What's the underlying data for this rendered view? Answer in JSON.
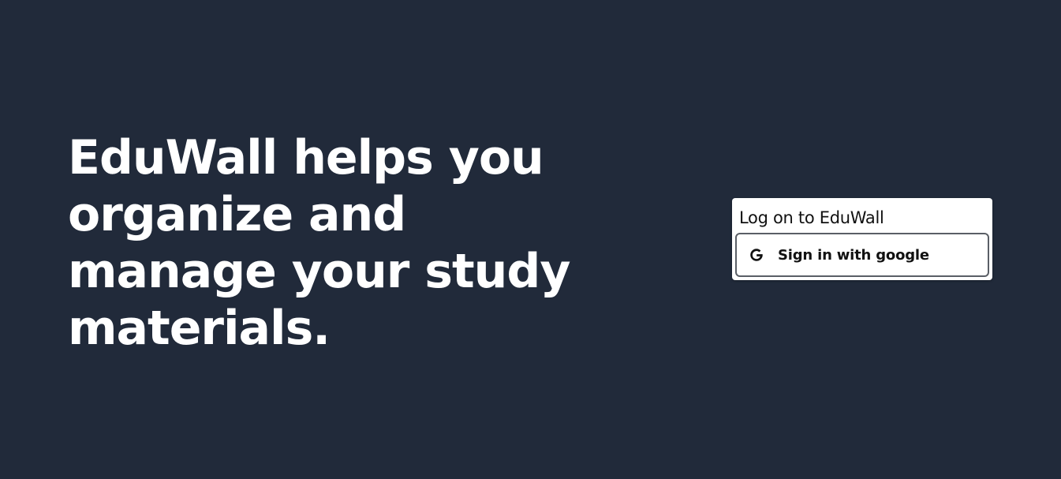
{
  "hero": {
    "title": "EduWall helps you organize and manage your study materials."
  },
  "login": {
    "title": "Log on to EduWall",
    "google_button_label": "Sign in with google",
    "google_icon": "google-g-icon"
  },
  "colors": {
    "background": "#212a3a",
    "hero_text": "#ffffff",
    "card_background": "#ffffff",
    "button_border": "#5a5f66"
  }
}
